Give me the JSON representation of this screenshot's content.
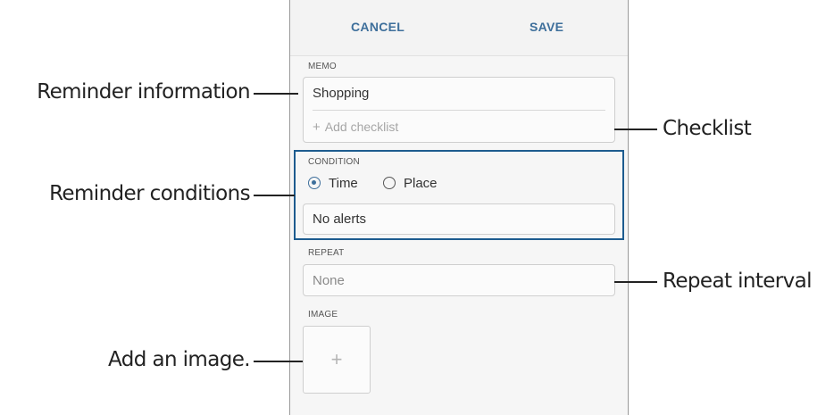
{
  "topbar": {
    "cancel_label": "CANCEL",
    "save_label": "SAVE"
  },
  "memo": {
    "section_label": "MEMO",
    "value": "Shopping",
    "add_checklist_label": "Add checklist",
    "add_checklist_icon": "+"
  },
  "condition": {
    "section_label": "CONDITION",
    "options": [
      {
        "label": "Time",
        "selected": true
      },
      {
        "label": "Place",
        "selected": false
      }
    ],
    "alert_value": "No alerts"
  },
  "repeat": {
    "section_label": "REPEAT",
    "value": "None"
  },
  "image": {
    "section_label": "IMAGE",
    "add_icon": "+"
  },
  "callouts": {
    "reminder_information": "Reminder information",
    "reminder_conditions": "Reminder conditions",
    "add_image": "Add an image.",
    "checklist": "Checklist",
    "repeat_interval": "Repeat interval"
  },
  "colors": {
    "accent": "#3e6f9b",
    "highlight_border": "#1d5c8f"
  }
}
